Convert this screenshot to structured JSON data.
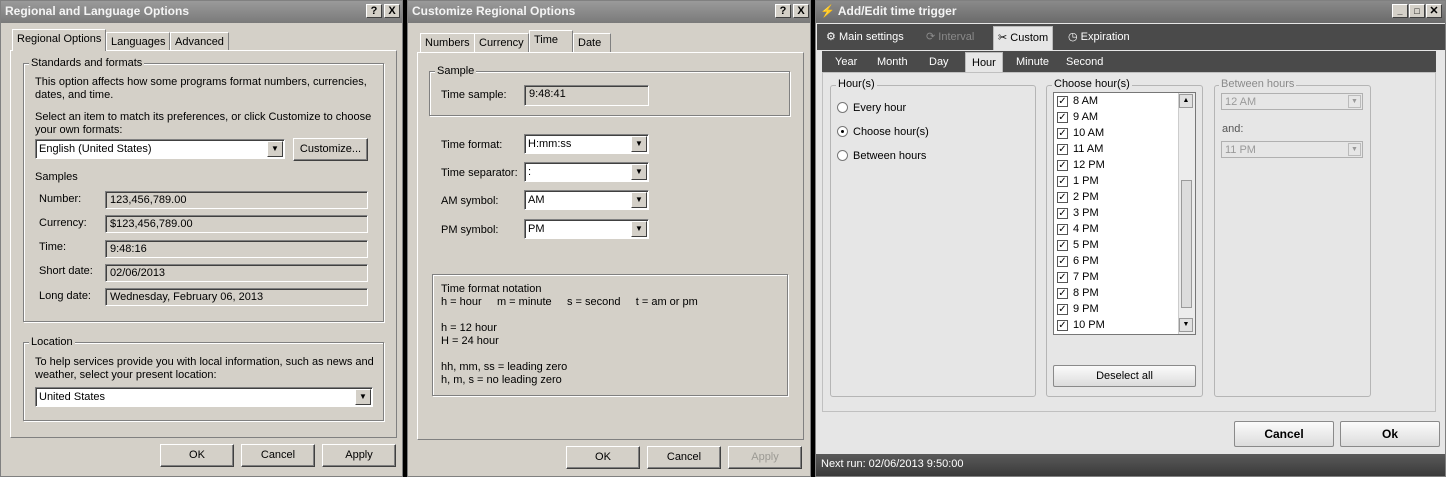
{
  "dialog1": {
    "title": "Regional and Language Options",
    "help": "?",
    "close": "X",
    "tabs": [
      "Regional Options",
      "Languages",
      "Advanced"
    ],
    "standards_legend": "Standards and formats",
    "standards_desc_1": "This option affects how some programs format numbers, currencies,",
    "standards_desc_2": "dates, and time.",
    "select_desc_1": "Select an item to match its preferences, or click Customize to choose",
    "select_desc_2": "your own formats:",
    "format_value": "English (United States)",
    "customize_button": "Customize...",
    "samples_label": "Samples",
    "samples": [
      {
        "label": "Number:",
        "value": "123,456,789.00"
      },
      {
        "label": "Currency:",
        "value": "$123,456,789.00"
      },
      {
        "label": "Time:",
        "value": "9:48:16"
      },
      {
        "label": "Short date:",
        "value": "02/06/2013"
      },
      {
        "label": "Long date:",
        "value": "Wednesday, February 06, 2013"
      }
    ],
    "location_legend": "Location",
    "location_desc_1": "To help services provide you with local information, such as news and",
    "location_desc_2": "weather, select your present location:",
    "location_value": "United States",
    "ok": "OK",
    "cancel": "Cancel",
    "apply": "Apply"
  },
  "dialog2": {
    "title": "Customize Regional Options",
    "help": "?",
    "close": "X",
    "tabs": [
      "Numbers",
      "Currency",
      "Time",
      "Date"
    ],
    "sample_legend": "Sample",
    "time_sample_label": "Time sample:",
    "time_sample_value": "9:48:41",
    "fields": [
      {
        "label": "Time format:",
        "value": "H:mm:ss"
      },
      {
        "label": "Time separator:",
        "value": ":"
      },
      {
        "label": "AM symbol:",
        "value": "AM"
      },
      {
        "label": "PM symbol:",
        "value": "PM"
      }
    ],
    "notation": [
      "Time format notation",
      "h = hour     m = minute     s = second     t = am or pm",
      "h = 12 hour",
      "H = 24 hour",
      "hh, mm, ss = leading zero",
      "h, m, s = no leading zero"
    ],
    "ok": "OK",
    "cancel": "Cancel",
    "apply": "Apply"
  },
  "dialog3": {
    "title": "Add/Edit time trigger",
    "main_tabs": [
      "Main settings",
      "Interval",
      "Custom",
      "Expiration"
    ],
    "sub_tabs": [
      "Year",
      "Month",
      "Day",
      "Hour",
      "Minute",
      "Second"
    ],
    "hours_legend": "Hour(s)",
    "radios": [
      "Every hour",
      "Choose hour(s)",
      "Between hours"
    ],
    "choose_legend": "Choose hour(s)",
    "hour_items": [
      "8 AM",
      "9 AM",
      "10 AM",
      "11 AM",
      "12 PM",
      "1 PM",
      "2 PM",
      "3 PM",
      "4 PM",
      "5 PM",
      "6 PM",
      "7 PM",
      "8 PM",
      "9 PM",
      "10 PM"
    ],
    "check_mark": "✓",
    "deselect_all": "Deselect all",
    "between_legend": "Between hours",
    "between_from": "12 AM",
    "and_label": "and:",
    "between_to": "11 PM",
    "cancel": "Cancel",
    "ok": "Ok",
    "status": "Next run: 02/06/2013 9:50:00"
  },
  "colors": {
    "win_bg": "#d4d0c8",
    "title_bg": "#8a8a8a",
    "dark_tabbar": "#4a4a4a"
  }
}
